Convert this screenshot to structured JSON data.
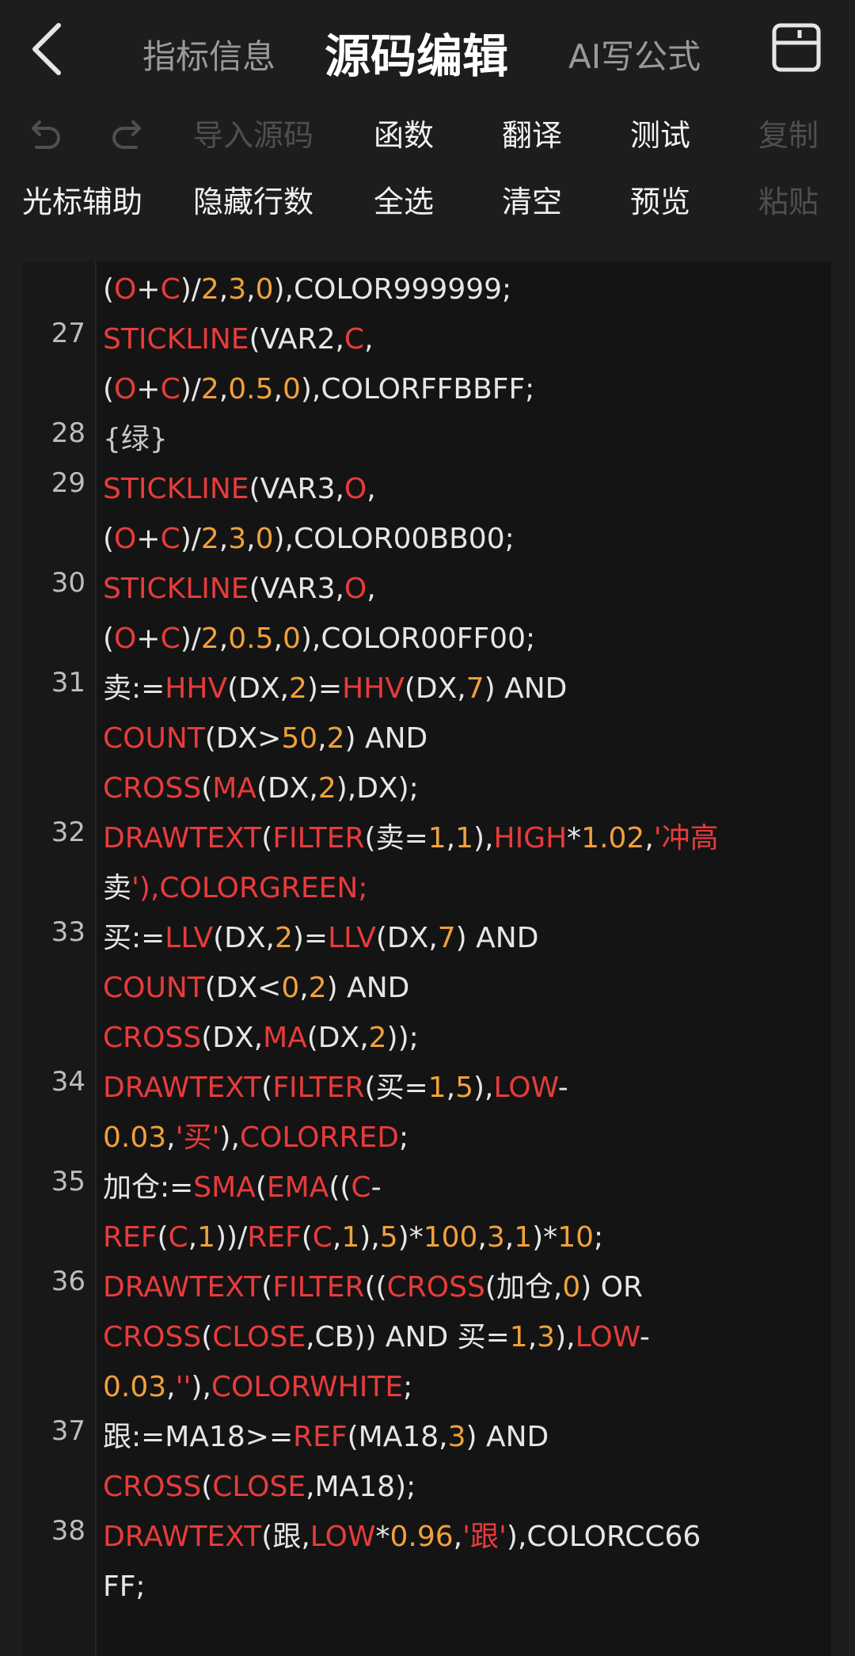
{
  "header": {
    "tabs": [
      {
        "label": "指标信息",
        "active": false
      },
      {
        "label": "源码编辑",
        "active": true
      },
      {
        "label": "AI写公式",
        "active": false
      }
    ],
    "back_icon": "chevron-left-icon",
    "save_icon": "save-icon"
  },
  "toolbar": {
    "row1": [
      {
        "type": "icon",
        "icon": "undo-icon",
        "disabled": true
      },
      {
        "type": "icon",
        "icon": "redo-icon",
        "disabled": true
      },
      {
        "label": "导入源码",
        "disabled": true
      },
      {
        "label": "函数",
        "disabled": false
      },
      {
        "label": "翻译",
        "disabled": false
      },
      {
        "label": "测试",
        "disabled": false
      },
      {
        "label": "复制",
        "disabled": true
      }
    ],
    "row2": [
      {
        "label": "光标辅助",
        "disabled": false
      },
      {
        "label": "隐藏行数",
        "disabled": false
      },
      {
        "label": "全选",
        "disabled": false
      },
      {
        "label": "清空",
        "disabled": false
      },
      {
        "label": "预览",
        "disabled": false
      },
      {
        "label": "粘贴",
        "disabled": true
      }
    ]
  },
  "colors": {
    "keyword": "#e83b3b",
    "number": "#f0a13c",
    "text": "#e6e6e6",
    "background": "#1d1d1d",
    "editor_bg": "#141414"
  },
  "editor": {
    "lines": [
      {
        "num": "",
        "text": "(O+C)/2,3,0),COLOR999999;"
      },
      {
        "num": "27",
        "text": "STICKLINE(VAR2,C,"
      },
      {
        "num": "",
        "text": "(O+C)/2,0.5,0),COLORFFBBFF;"
      },
      {
        "num": "28",
        "text": "{绿}"
      },
      {
        "num": "29",
        "text": "STICKLINE(VAR3,O,"
      },
      {
        "num": "",
        "text": "(O+C)/2,3,0),COLOR00BB00;"
      },
      {
        "num": "30",
        "text": "STICKLINE(VAR3,O,"
      },
      {
        "num": "",
        "text": "(O+C)/2,0.5,0),COLOR00FF00;"
      },
      {
        "num": "31",
        "text": "卖:=HHV(DX,2)=HHV(DX,7) AND"
      },
      {
        "num": "",
        "text": "COUNT(DX>50,2) AND"
      },
      {
        "num": "",
        "text": "CROSS(MA(DX,2),DX);"
      },
      {
        "num": "32",
        "text": "DRAWTEXT(FILTER(卖=1,1),HIGH*1.02,'冲高"
      },
      {
        "num": "",
        "text": "卖'),COLORGREEN;"
      },
      {
        "num": "33",
        "text": "买:=LLV(DX,2)=LLV(DX,7) AND"
      },
      {
        "num": "",
        "text": "COUNT(DX<0,2) AND"
      },
      {
        "num": "",
        "text": "CROSS(DX,MA(DX,2));"
      },
      {
        "num": "34",
        "text": "DRAWTEXT(FILTER(买=1,5),LOW-"
      },
      {
        "num": "",
        "text": "0.03,'买'),COLORRED;"
      },
      {
        "num": "35",
        "text": "加仓:=SMA(EMA((C-"
      },
      {
        "num": "",
        "text": "REF(C,1))/REF(C,1),5)*100,3,1)*10;"
      },
      {
        "num": "36",
        "text": "DRAWTEXT(FILTER((CROSS(加仓,0) OR"
      },
      {
        "num": "",
        "text": "CROSS(CLOSE,CB)) AND 买=1,3),LOW-"
      },
      {
        "num": "",
        "text": "0.03,''),COLORWHITE;"
      },
      {
        "num": "37",
        "text": "跟:=MA18>=REF(MA18,3) AND"
      },
      {
        "num": "",
        "text": "CROSS(CLOSE,MA18);"
      },
      {
        "num": "38",
        "text": "DRAWTEXT(跟,LOW*0.96,'跟'),COLORCC66"
      },
      {
        "num": "",
        "text": "FF;"
      }
    ]
  }
}
